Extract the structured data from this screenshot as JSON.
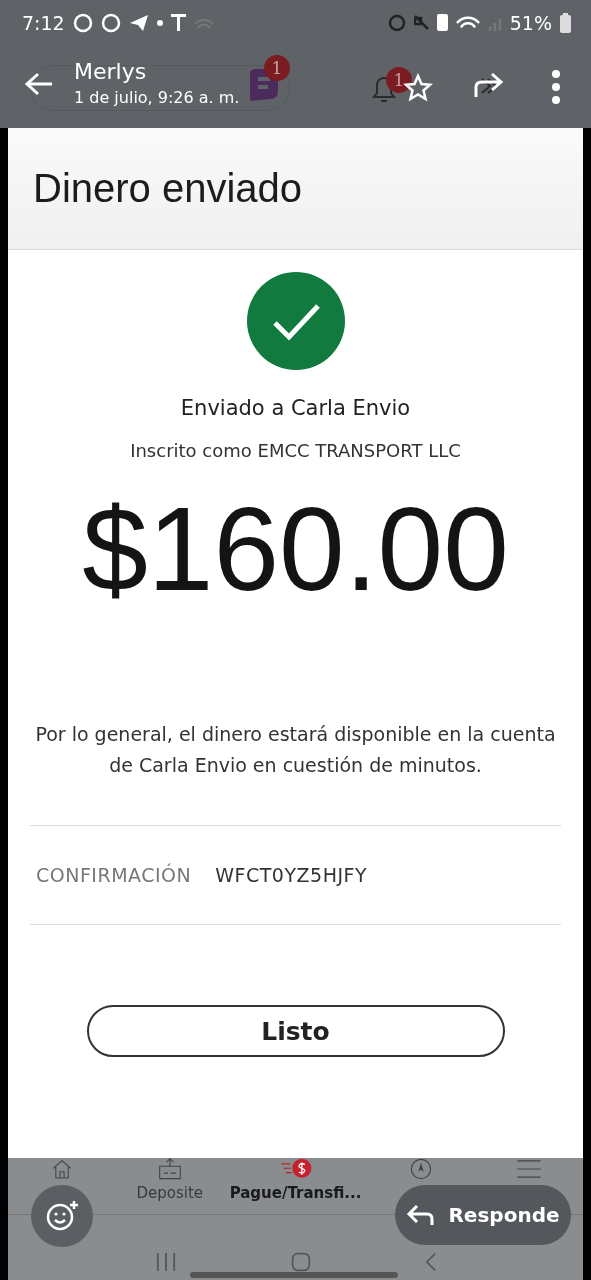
{
  "status_bar": {
    "time": "7:12",
    "battery": "51%"
  },
  "viewer": {
    "sender": "Merlys",
    "date": "1 de julio, 9:26 a. m."
  },
  "app_bar": {
    "message_badge": "1",
    "alert_badge": "1"
  },
  "page": {
    "title": "Dinero enviado",
    "recipient": "Enviado a Carla Envio",
    "enrolled": "Inscrito como EMCC TRANSPORT LLC",
    "amount": "$160.00",
    "note": "Por lo general, el dinero estará disponible en la cuenta de Carla Envio en cuestión de minutos.",
    "confirmation_label": "CONFIRMACIÓN",
    "confirmation_value": "WFCT0YZ5HJFY",
    "done_button": "Listo"
  },
  "bottom_nav": [
    {
      "kind": "home",
      "selected": false
    },
    {
      "kind": "deposit",
      "label": "Deposite",
      "selected": false
    },
    {
      "kind": "pay",
      "label": "Pague/Transfi...",
      "selected": true
    },
    {
      "kind": "explore",
      "selected": false
    },
    {
      "kind": "menu",
      "selected": false
    }
  ],
  "reply_button": "Responde"
}
